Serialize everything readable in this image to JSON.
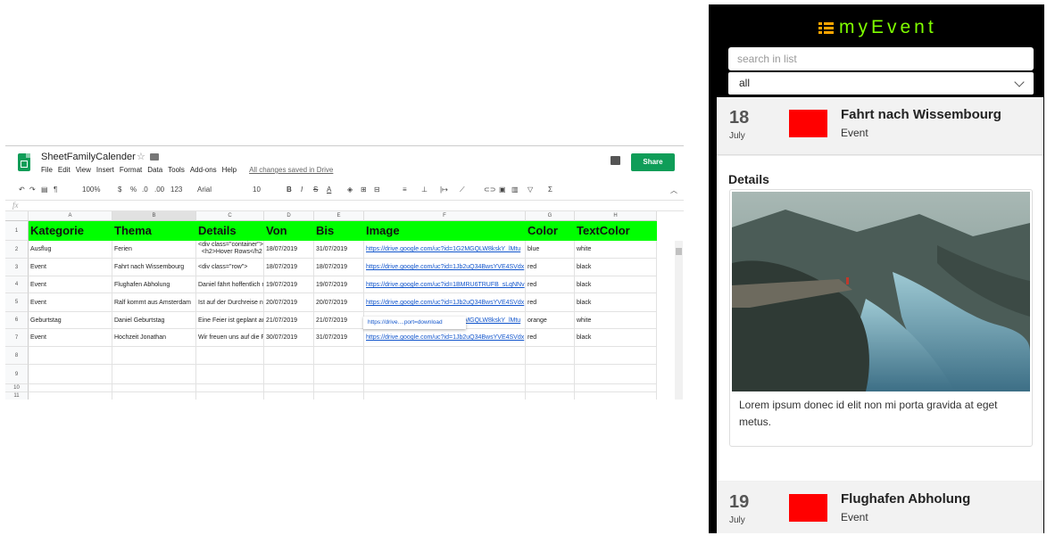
{
  "sheet": {
    "title": "SheetFamilyCalender",
    "menu": [
      "File",
      "Edit",
      "View",
      "Insert",
      "Format",
      "Data",
      "Tools",
      "Add-ons",
      "Help"
    ],
    "saved_status": "All changes saved in Drive",
    "share_label": "Share",
    "toolbar": {
      "zoom": "100%",
      "currency": "$",
      "percent": "%",
      "dec_less": ".0",
      "dec_more": ".00",
      "number_format": "123",
      "font": "Arial",
      "font_size": "10"
    },
    "fx_label": "fx",
    "columns": [
      "A",
      "B",
      "C",
      "D",
      "E",
      "F",
      "G",
      "H"
    ],
    "header_row": [
      "Kategorie",
      "Thema",
      "Details",
      "Von",
      "Bis",
      "Image",
      "Color",
      "TextColor"
    ],
    "rows": [
      [
        "Ausflug",
        "Ferien",
        "<div class=\"container\">\n  <h2>Hover Rows</h2",
        "18/07/2019",
        "31/07/2019",
        "https://drive.google.com/uc?id=1G2MGQLW8kskY_lMtu",
        "blue",
        "white"
      ],
      [
        "Event",
        "Fahrt nach Wissembourg",
        "<div class=\"row\">",
        "18/07/2019",
        "18/07/2019",
        "https://drive.google.com/uc?id=1Jb2uQ34BwsYVE4SVdx",
        "red",
        "black"
      ],
      [
        "Event",
        "Flughafen Abholung",
        "Daniel fährt hoffentlich mit",
        "19/07/2019",
        "19/07/2019",
        "https://drive.google.com/uc?id=1BMRU6TRUFB_sLqNNv",
        "red",
        "black"
      ],
      [
        "Event",
        "Ralf kommt aus Amsterdam",
        "Ist auf der Durchreise nach",
        "20/07/2019",
        "20/07/2019",
        "https://drive.google.com/uc?id=1Jb2uQ34BwsYVE4SVdx",
        "red",
        "black"
      ],
      [
        "Geburtstag",
        "Daniel Geburtstag",
        "Eine Feier ist geplant am",
        "21/07/2019",
        "21/07/2019",
        "https://drive.google.com/uc?id=1G2MGQLW8kskY_lMtu",
        "orange",
        "white"
      ],
      [
        "Event",
        "Hochzeit Jonathan",
        "Wir freuen uns auf die Feier",
        "30/07/2019",
        "31/07/2019",
        "https://drive.google.com/uc?id=1Jb2uQ34BwsYVE4SVdx",
        "red",
        "black"
      ]
    ],
    "row_numbers": [
      "1",
      "2",
      "3",
      "4",
      "5",
      "6",
      "7",
      "8",
      "9",
      "10",
      "11"
    ],
    "tooltip": "https://drive....port=download"
  },
  "app": {
    "title": "myEvent",
    "search_placeholder": "search in list",
    "filter_value": "all",
    "events": [
      {
        "day": "18",
        "month": "July",
        "title": "Fahrt nach Wissembourg",
        "category": "Event",
        "color": "#ff0000"
      },
      {
        "day": "19",
        "month": "July",
        "title": "Flughafen Abholung",
        "category": "Event",
        "color": "#ff0000"
      }
    ],
    "details_heading": "Details",
    "details_text": "Lorem ipsum donec id elit non mi porta gravida at eget metus."
  }
}
